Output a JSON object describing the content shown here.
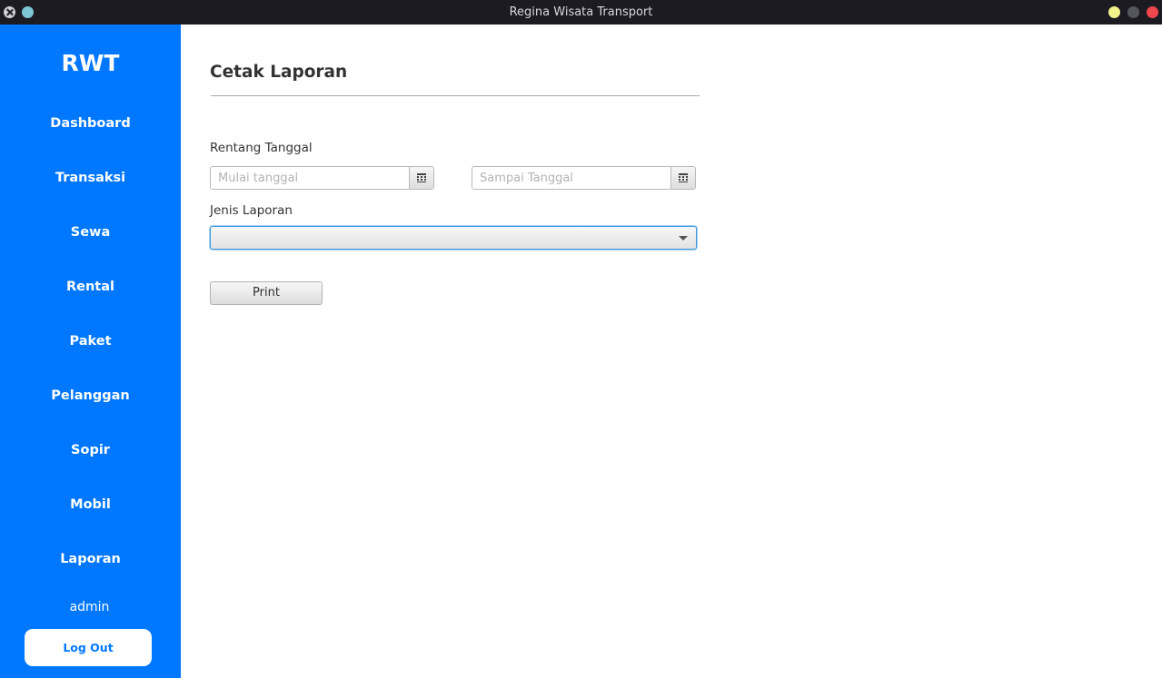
{
  "window": {
    "title": "Regina Wisata Transport"
  },
  "sidebar": {
    "brand": "RWT",
    "items": [
      {
        "label": "Dashboard"
      },
      {
        "label": "Transaksi"
      },
      {
        "label": "Sewa"
      },
      {
        "label": "Rental"
      },
      {
        "label": "Paket"
      },
      {
        "label": "Pelanggan"
      },
      {
        "label": "Sopir"
      },
      {
        "label": "Mobil"
      },
      {
        "label": "Laporan"
      }
    ],
    "user": "admin",
    "logout_label": "Log Out",
    "background_color": "#0077ff"
  },
  "main": {
    "title": "Cetak Laporan",
    "date_range_label": "Rentang Tanggal",
    "start_date": {
      "value": "",
      "placeholder": "Mulai tanggal"
    },
    "end_date": {
      "value": "",
      "placeholder": "Sampai Tanggal"
    },
    "report_type_label": "Jenis Laporan",
    "report_type": {
      "selected": ""
    },
    "print_label": "Print"
  }
}
